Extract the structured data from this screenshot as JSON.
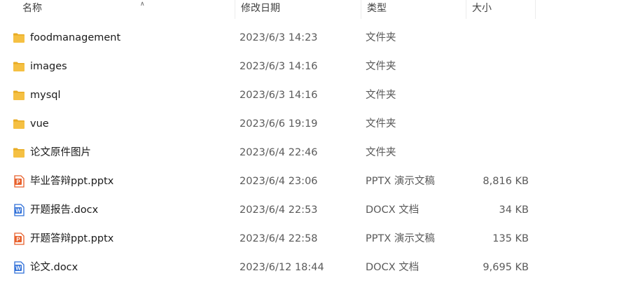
{
  "columns": {
    "name": "名称",
    "date": "修改日期",
    "type": "类型",
    "size": "大小"
  },
  "files": [
    {
      "name": "foodmanagement",
      "date": "2023/6/3 14:23",
      "type": "文件夹",
      "size": "",
      "icon": "folder-icon"
    },
    {
      "name": "images",
      "date": "2023/6/3 14:16",
      "type": "文件夹",
      "size": "",
      "icon": "folder-icon"
    },
    {
      "name": "mysql",
      "date": "2023/6/3 14:16",
      "type": "文件夹",
      "size": "",
      "icon": "folder-icon"
    },
    {
      "name": "vue",
      "date": "2023/6/6 19:19",
      "type": "文件夹",
      "size": "",
      "icon": "folder-icon"
    },
    {
      "name": "论文原件图片",
      "date": "2023/6/4 22:46",
      "type": "文件夹",
      "size": "",
      "icon": "folder-icon"
    },
    {
      "name": "毕业答辩ppt.pptx",
      "date": "2023/6/4 23:06",
      "type": "PPTX 演示文稿",
      "size": "8,816 KB",
      "icon": "pptx-file-icon"
    },
    {
      "name": "开题报告.docx",
      "date": "2023/6/4 22:53",
      "type": "DOCX 文档",
      "size": "34 KB",
      "icon": "docx-file-icon"
    },
    {
      "name": "开题答辩ppt.pptx",
      "date": "2023/6/4 22:58",
      "type": "PPTX 演示文稿",
      "size": "135 KB",
      "icon": "pptx-file-icon"
    },
    {
      "name": "论文.docx",
      "date": "2023/6/12 18:44",
      "type": "DOCX 文档",
      "size": "9,695 KB",
      "icon": "docx-file-icon"
    }
  ],
  "colors": {
    "folder": "#f5c043",
    "folder_dark": "#e8ab23",
    "pptx": "#e8612c",
    "docx": "#2f6fd8"
  }
}
